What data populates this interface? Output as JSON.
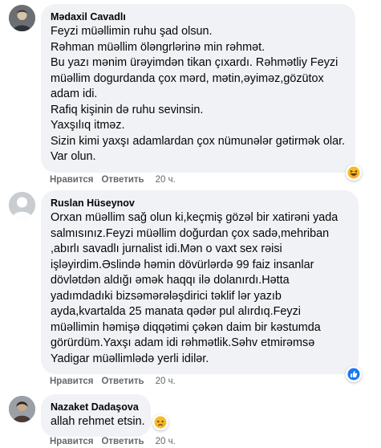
{
  "comments": [
    {
      "author": "Mədaxil Cavadlı",
      "lines": [
        "Feyzi müəllimin ruhu şad olsun.",
        "Rəhman müəllim öləngrlərinə min rəhmət.",
        "Bu yazı mənim ürəyimdən tikan çıxardı. Rəhmətliy Feyzi",
        "müəllim dogurdanda çox mərd, mətin,əyiməz,gözütox",
        "adam idi.",
        "Rafiq kişinin də ruhu sevinsin.",
        "Yaxşılıq itməz.",
        "Sizin kimi yaxşı adamlardan çox nümunələr gətirmək olar.",
        "Var olun."
      ],
      "like_label": "Нравится",
      "reply_label": "Ответить",
      "time": "20 ч.",
      "reaction_icon": "haha-emoji-icon"
    },
    {
      "author": "Ruslan Hüseynov",
      "lines": [
        "Orxan müəllim sağ olun ki,keçmiş gözəl bir xatirəni yada",
        "salmısınız.Feyzi müəllim doğurdan çox sadə,mehriban",
        ",abırlı savadlı jurnalist idi.Mən o vaxt sex rəisi",
        "işləyirdim.Əslində həmin dövürlərdə 99 faiz insanlar",
        "dövlətdən aldığı əmək haqqı ilə dolanırdı.Hətta",
        "yadımdadıki bizsəmərələşdirici təklif lər yazıb",
        "ayda,kvartalda 25 manata qədər pul alırdıq.Feyzi",
        "müəllimin həmişə diqqətimi çəkən daim bir kəstumda",
        "görürdüm.Yaxşı adam idi rəhmətlik.Səhv etmirəmsə",
        "Yadigar müəllimlədə yerli idilər."
      ],
      "like_label": "Нравится",
      "reply_label": "Ответить",
      "time": "20 ч.",
      "reaction_icon": "like-thumb-icon"
    },
    {
      "author": "Nazaket Dadaşova",
      "lines": [
        "allah rehmet etsin."
      ],
      "like_label": "Нравится",
      "reply_label": "Ответить",
      "time": "20 ч.",
      "reaction_icon": "sad-emoji-icon"
    }
  ],
  "colors": {
    "bubble": "#f0f2f5",
    "meta_text": "#65676b",
    "like_blue": "#1877f2",
    "haha_yellow": "#f7b928"
  }
}
